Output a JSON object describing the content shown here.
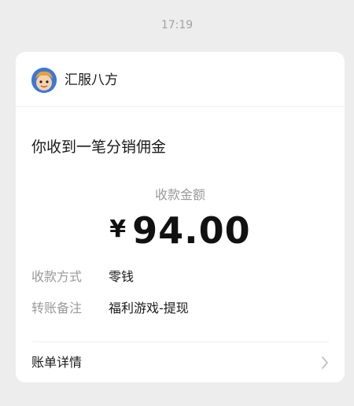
{
  "timestamp": "17:19",
  "card": {
    "app_name": "汇服八方",
    "avatar_icon": "cartoon-avatar-icon",
    "title": "你收到一笔分销佣金",
    "amount_label": "收款金额",
    "currency_symbol": "¥",
    "amount": "94.00",
    "details": [
      {
        "key": "收款方式",
        "value": "零钱"
      },
      {
        "key": "转账备注",
        "value": "福利游戏-提现"
      }
    ],
    "bill_details_label": "账单详情",
    "chevron_icon": "chevron-right-icon"
  },
  "colors": {
    "background": "#ededed",
    "card": "#ffffff",
    "muted_text": "#9a9a9a",
    "primary_text": "#1a1a1a",
    "avatar_bg": "#3d78d6"
  }
}
